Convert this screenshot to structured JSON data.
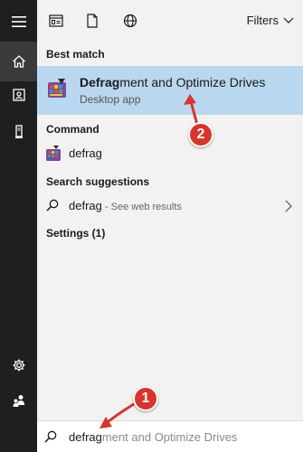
{
  "rail": {
    "items": [
      {
        "icon": "hamburger-menu-icon"
      },
      {
        "icon": "home-icon",
        "active": true
      },
      {
        "icon": "document-icon"
      },
      {
        "icon": "tower-pc-icon"
      },
      {
        "icon": "settings-icon"
      },
      {
        "icon": "feedback-people-icon"
      }
    ]
  },
  "topbar": {
    "icons": [
      "apps-icon",
      "documents-icon",
      "web-icon"
    ],
    "filters_label": "Filters"
  },
  "results": {
    "best_match_heading": "Best match",
    "best_match": {
      "title_bold": "Defrag",
      "title_rest": "ment and Optimize Drives",
      "subtitle": "Desktop app"
    },
    "command_heading": "Command",
    "command": {
      "label": "defrag"
    },
    "suggestions_heading": "Search suggestions",
    "suggestion": {
      "label": "defrag",
      "hint": " - See web results"
    },
    "settings_heading": "Settings (1)"
  },
  "search": {
    "typed": "defrag",
    "autocomplete": "ment and Optimize Drives"
  },
  "annotations": {
    "badge1": "1",
    "badge2": "2",
    "color": "#d9342b"
  },
  "colors": {
    "rail": "#1f1f1f",
    "panel": "#f2f2f2",
    "highlight": "#b9d8ef"
  }
}
